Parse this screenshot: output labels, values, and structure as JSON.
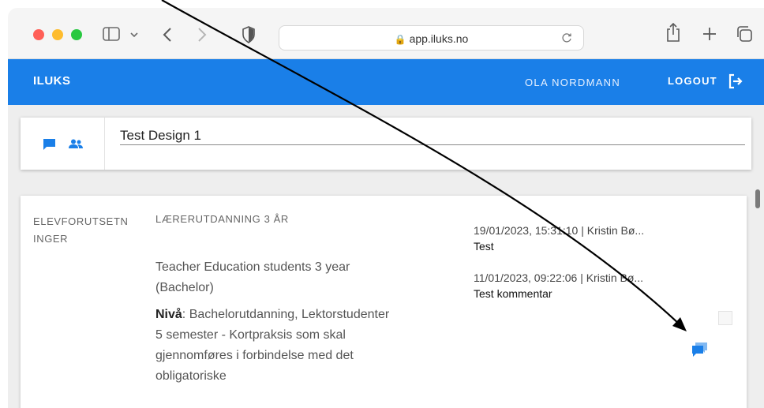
{
  "browser": {
    "url": "app.iluks.no"
  },
  "header": {
    "logo": "ILUKS",
    "user_name": "OLA NORDMANN",
    "logout_label": "LOGOUT"
  },
  "design": {
    "title": "Test Design 1"
  },
  "section": {
    "label": "ELEVFORUTSETNINGER",
    "heading": "LÆRERUTDANNING 3 ÅR",
    "description": "Teacher Education students 3 year (Bachelor)",
    "level_label": "Nivå",
    "level_text": ": Bachelorutdanning, Lektorstudenter 5 semester - Kortpraksis som skal gjennomføres i forbindelse med det obligatoriske"
  },
  "comments": [
    {
      "meta": "19/01/2023, 15:31:10 | Kristin Bø...",
      "text": "Test"
    },
    {
      "meta": "11/01/2023, 09:22:06 | Kristin Bø...",
      "text": "Test kommentar"
    }
  ],
  "colors": {
    "header": "#1a7fe8",
    "accent": "#1a7fe8"
  },
  "icons": {
    "back": "chevron-left-icon",
    "forward": "chevron-right-icon",
    "sidebar": "sidebar-icon",
    "shield": "shield-icon",
    "lock": "lock-icon",
    "reload": "reload-icon",
    "share": "share-icon",
    "new_tab": "plus-icon",
    "tabs": "tabs-overview-icon",
    "comment": "comment-icon",
    "users": "users-icon",
    "logout": "logout-icon"
  }
}
